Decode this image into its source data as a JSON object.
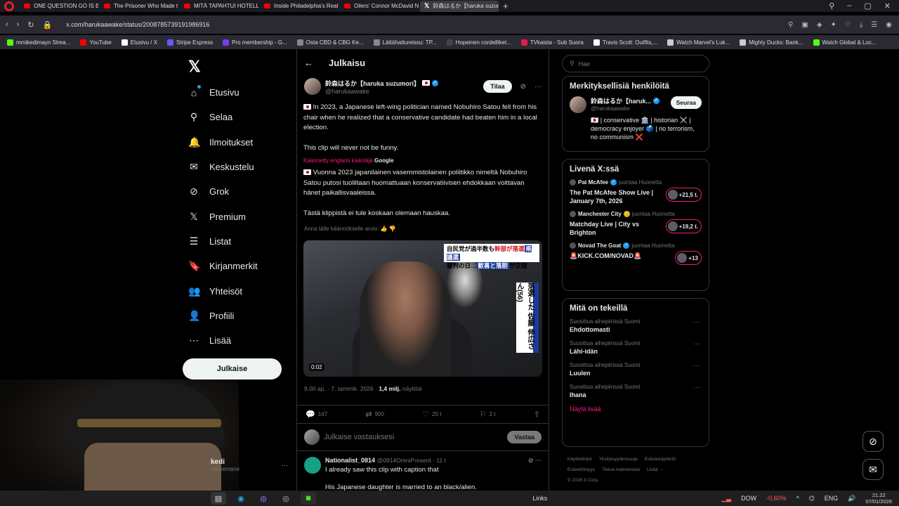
{
  "browser": {
    "tabs": [
      {
        "label": "ONE QUESTION GO IS BA",
        "icon": "youtube-icon"
      },
      {
        "label": "The Prisoner Who Made t",
        "icon": "youtube-icon"
      },
      {
        "label": "MITÄ TAPAHTUI HOTELLI",
        "icon": "youtube-icon"
      },
      {
        "label": "Inside Philadelphia's Real",
        "icon": "youtube-icon"
      },
      {
        "label": "Oilers' Connor McDavid N",
        "icon": "youtube-icon"
      },
      {
        "label": "鈴森はるか【haruka suzum",
        "icon": "x-icon",
        "active": true
      }
    ],
    "url": "x.com/harukaawake/status/2008785739191986916",
    "bookmarks": [
      {
        "label": "mmikedimayn Strea...",
        "color": "#53fc18"
      },
      {
        "label": "YouTube",
        "color": "#ff0000"
      },
      {
        "label": "Etusivu / X",
        "color": "#ffffff"
      },
      {
        "label": "Stripe Express",
        "color": "#635bff"
      },
      {
        "label": "Pro membership - G...",
        "color": "#7c3aed"
      },
      {
        "label": "Osta CBD & CBG Ke...",
        "color": "#888888"
      },
      {
        "label": "Lättähattureissu: TP...",
        "color": "#888888"
      },
      {
        "label": "Hopeinen cordelliket...",
        "color": "#444444"
      },
      {
        "label": "TVkaista - Sub Suora",
        "color": "#e11d48"
      },
      {
        "label": "Travis Scott: Outfits,...",
        "color": "#ffffff"
      },
      {
        "label": "Watch Marvel's Luk...",
        "color": "#cccccc"
      },
      {
        "label": "Mighty Ducks: Bank...",
        "color": "#cccccc"
      },
      {
        "label": "Watch Global & Loc...",
        "color": "#53fc18"
      }
    ]
  },
  "nav": {
    "items": [
      {
        "label": "Etusivu",
        "icon": "home-icon",
        "glyph": "⌂"
      },
      {
        "label": "Selaa",
        "icon": "search-icon",
        "glyph": "⚲"
      },
      {
        "label": "Ilmoitukset",
        "icon": "bell-icon",
        "glyph": "🔔"
      },
      {
        "label": "Keskustelu",
        "icon": "mail-icon",
        "glyph": "✉"
      },
      {
        "label": "Grok",
        "icon": "grok-icon",
        "glyph": "⊘"
      },
      {
        "label": "Premium",
        "icon": "x-premium-icon",
        "glyph": "𝕏"
      },
      {
        "label": "Listat",
        "icon": "list-icon",
        "glyph": "☰"
      },
      {
        "label": "Kirjanmerkit",
        "icon": "bookmark-icon",
        "glyph": "🔖"
      },
      {
        "label": "Yhteisöt",
        "icon": "communities-icon",
        "glyph": "👥"
      },
      {
        "label": "Profiili",
        "icon": "profile-icon",
        "glyph": "👤"
      },
      {
        "label": "Lisää",
        "icon": "more-icon",
        "glyph": "⋯"
      }
    ],
    "post_button": "Julkaise",
    "profile_name": "kedi",
    "profile_handle": "mikkemane"
  },
  "post": {
    "header_title": "Julkaisu",
    "author_name": "鈴森はるか【haruka suzumori】",
    "author_handle": "@harukaawake",
    "subscribe_label": "Tilaa",
    "text_p1": "In 2023, a Japanese left-wing politician named Nobuhiro Satou fell from his chair when he realized that a conservative candidate had beaten him in a local election.",
    "text_p2": "This clip will never not be funny.",
    "translated_prefix": "Käännetty englanti kääntäjä",
    "translated_by": "Google",
    "trans_p1": "Vuonna 2023 japanilainen vasemmistolainen poliitikko nimeltä Nobuhiro Satou putosi tuoliltaan huomattuaan konservatiivisen ehdokkaan voittavan hänet paikallisvaaleissa.",
    "trans_p2": "Tästä klippistä ei tule koskaan olemaan hauskaa.",
    "rate_translation": "Anna tälle käännökselle arvio:",
    "video_caption_line1": "自民党が過半数も",
    "video_caption_red": "幹部が落選",
    "video_caption_line2": "審判の日…",
    "video_caption_blue1": "歓喜と落胆",
    "video_caption_line3": "が交錯",
    "video_caption_tag": "県議選",
    "video_side_caption": "落選した 佐藤 伸広さん(56)",
    "video_time": "0:02",
    "timestamp": "9.00 ap. · 7. tammik. 2026 ·",
    "views_count": "1,4 milj.",
    "views_label": "näyttöä",
    "replies": "147",
    "reposts": "900",
    "likes": "20 t",
    "bookmarks": "2 t",
    "reply_placeholder": "Julkaise vastauksesi",
    "reply_button": "Vastaa"
  },
  "first_reply": {
    "name": "Nationalist_0814",
    "handle": "@0914OmniPresent",
    "time": "· 11 t",
    "line1": "I already saw this clip with caption that",
    "line2": "His Japanese daughter is married to an black/alien."
  },
  "sidebar": {
    "search_placeholder": "Hae",
    "relevant_title": "Merkityksellisiä henkilöitä",
    "relevant_name": "鈴森はるか【haruk...",
    "relevant_handle": "@harukaawake",
    "follow_label": "Seuraa",
    "relevant_bio": "🇯🇵 | conservative 🏛️ | historian ⚔️ | democracy enjoyer 🗳️ | no terrorism, no communism ❌",
    "live_title": "Livenä X:ssä",
    "live": [
      {
        "source": "Pat McAfee",
        "badge_verified": "blue",
        "action": "juontaa Huonetta",
        "title": "The Pat McAfee Show Live | January 7th, 2026",
        "count": "+21,5 t."
      },
      {
        "source": "Manchester City",
        "badge_verified": "gold",
        "action": "juontaa Huonetta",
        "title": "Matchday Live | City vs Brighton",
        "count": "+19,2 t."
      },
      {
        "source": "Novad The Goat",
        "badge_verified": "blue",
        "action": "juontaa Huonetta",
        "title": "🚨KICK.COM/NOVAD🚨",
        "count": "+13"
      }
    ],
    "happening_title": "Mitä on tekeillä",
    "happening": [
      {
        "category": "Suosittua aihepiirissä Suomi",
        "name": "Ehdottomasti"
      },
      {
        "category": "Suosittua aihepiirissä Suomi",
        "name": "Lähi-idän"
      },
      {
        "category": "Suosittua aihepiirissä Suomi",
        "name": "Luulen"
      },
      {
        "category": "Suosittua aihepiirissä Suomi",
        "name": "Ihana"
      }
    ],
    "show_more": "Näytä lisää",
    "footer": [
      "Käyttöehdot",
      "Yksityisyydensuoja",
      "Evästekäytäntö",
      "Esteettömyys",
      "Tietoa mainoksista",
      "Lisää ···",
      "© 2026 X Corp."
    ]
  },
  "taskbar": {
    "links": "Links",
    "dow": "DOW",
    "dow_change": "-0,60%",
    "lang": "ENG",
    "time": "21.22",
    "date": "07/01/2026"
  }
}
